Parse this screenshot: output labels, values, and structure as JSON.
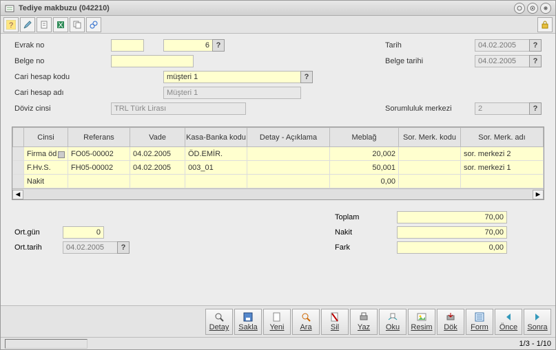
{
  "window": {
    "title": "Tediye makbuzu (042210)"
  },
  "labels": {
    "evrak_no": "Evrak no",
    "belge_no": "Belge no",
    "cari_hesap_kodu": "Cari hesap kodu",
    "cari_hesap_adi": "Cari hesap adı",
    "doviz_cinsi": "Döviz cinsi",
    "tarih": "Tarih",
    "belge_tarihi": "Belge tarihi",
    "sorumluluk_merkezi": "Sorumluluk merkezi",
    "ort_gun": "Ort.gün",
    "ort_tarih": "Ort.tarih",
    "toplam": "Toplam",
    "nakit": "Nakit",
    "fark": "Fark"
  },
  "fields": {
    "evrak_seri": "",
    "evrak_sira": "6",
    "belge_no": "",
    "cari_hesap_kodu": "müşteri 1",
    "cari_hesap_adi": "Müşteri 1",
    "doviz_cinsi": "TRL Türk Lirası",
    "tarih": "04.02.2005",
    "belge_tarihi": "04.02.2005",
    "sorumluluk_merkezi": "2",
    "ort_gun": "0",
    "ort_tarih": "04.02.2005",
    "toplam": "70,00",
    "nakit": "70,00",
    "fark": "0,00"
  },
  "grid": {
    "headers": {
      "cinsi": "Cinsi",
      "referans": "Referans",
      "vade": "Vade",
      "kasa_banka": "Kasa-Banka kodu",
      "detay": "Detay - Açıklama",
      "meblag": "Meblağ",
      "smk": "Sor. Merk. kodu",
      "sma": "Sor. Merk. adı"
    },
    "rows": [
      {
        "cinsi": "Firma öd",
        "referans": "FO05-00002",
        "vade": "04.02.2005",
        "kasa": "ÖD.EMİR.",
        "detay": "",
        "meblag": "20,002",
        "smk": "",
        "sma": "sor. merkezi 2"
      },
      {
        "cinsi": "F.Hv.S.",
        "referans": "FH05-00002",
        "vade": "04.02.2005",
        "kasa": "003_01",
        "detay": "",
        "meblag": "50,001",
        "smk": "",
        "sma": "sor. merkezi 1"
      },
      {
        "cinsi": "Nakit",
        "referans": "",
        "vade": "",
        "kasa": "",
        "detay": "",
        "meblag": "0,00",
        "smk": "",
        "sma": ""
      }
    ]
  },
  "actions": {
    "detay": "Detay",
    "sakla": "Sakla",
    "yeni": "Yeni",
    "ara": "Ara",
    "sil": "Sil",
    "yaz": "Yaz",
    "oku": "Oku",
    "resim": "Resim",
    "dok": "Dök",
    "form": "Form",
    "once": "Önce",
    "sonra": "Sonra"
  },
  "status": {
    "pager": "1/3 - 1/10"
  },
  "chart_data": {
    "type": "table",
    "title": "Tediye makbuzu hareket satırları",
    "columns": [
      "Cinsi",
      "Referans",
      "Vade",
      "Kasa-Banka kodu",
      "Detay - Açıklama",
      "Meblağ",
      "Sor. Merk. kodu",
      "Sor. Merk. adı"
    ],
    "rows": [
      [
        "Firma öd",
        "FO05-00002",
        "04.02.2005",
        "ÖD.EMİR.",
        "",
        20002,
        "",
        "sor. merkezi 2"
      ],
      [
        "F.Hv.S.",
        "FH05-00002",
        "04.02.2005",
        "003_01",
        "",
        50001,
        "",
        "sor. merkezi 1"
      ],
      [
        "Nakit",
        "",
        "",
        "",
        "",
        0.0,
        "",
        ""
      ]
    ],
    "totals": {
      "Toplam": 70.0,
      "Nakit": 70.0,
      "Fark": 0.0
    }
  }
}
